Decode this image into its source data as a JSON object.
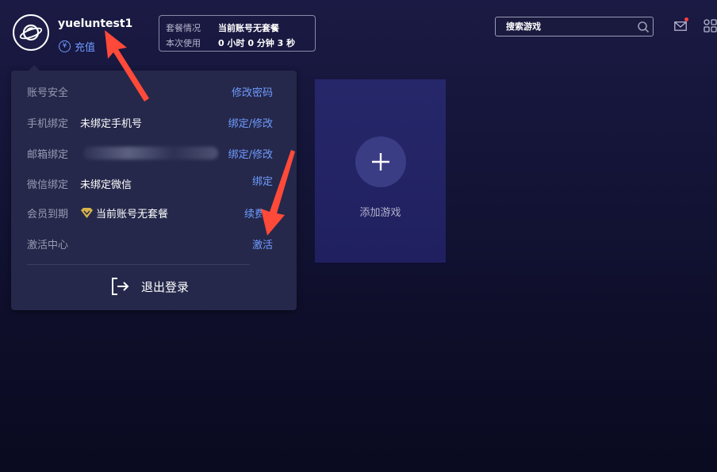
{
  "header": {
    "username": "yueluntest1",
    "recharge_label": "充值",
    "yen_symbol": "¥",
    "plan": {
      "status_label": "套餐情况",
      "status_value": "当前账号无套餐",
      "usage_label": "本次使用",
      "usage_value": "0 小时 0 分钟 3 秒"
    },
    "search_placeholder": "搜索游戏"
  },
  "account_menu": {
    "items": [
      {
        "label": "账号安全",
        "value": "",
        "action": "修改密码"
      },
      {
        "label": "手机绑定",
        "value": "未绑定手机号",
        "action": "绑定/修改"
      },
      {
        "label": "邮箱绑定",
        "value": "",
        "action": "绑定/修改"
      },
      {
        "label": "微信绑定",
        "value": "未绑定微信",
        "action": "绑定"
      },
      {
        "label": "会员到期",
        "value": "当前账号无套餐",
        "action": "续费"
      },
      {
        "label": "激活中心",
        "value": "",
        "action": "激活"
      }
    ],
    "logout_label": "退出登录"
  },
  "main": {
    "add_game_label": "添加游戏"
  },
  "colors": {
    "accent": "#6f9bff",
    "arrow": "#ff4a3a",
    "card": "#26276a",
    "vip": "#d8b24a"
  },
  "icons": [
    "planet-logo-icon",
    "yen-icon",
    "search-icon",
    "mail-icon",
    "apps-grid-icon",
    "vip-diamond-icon",
    "logout-icon",
    "plus-icon"
  ]
}
